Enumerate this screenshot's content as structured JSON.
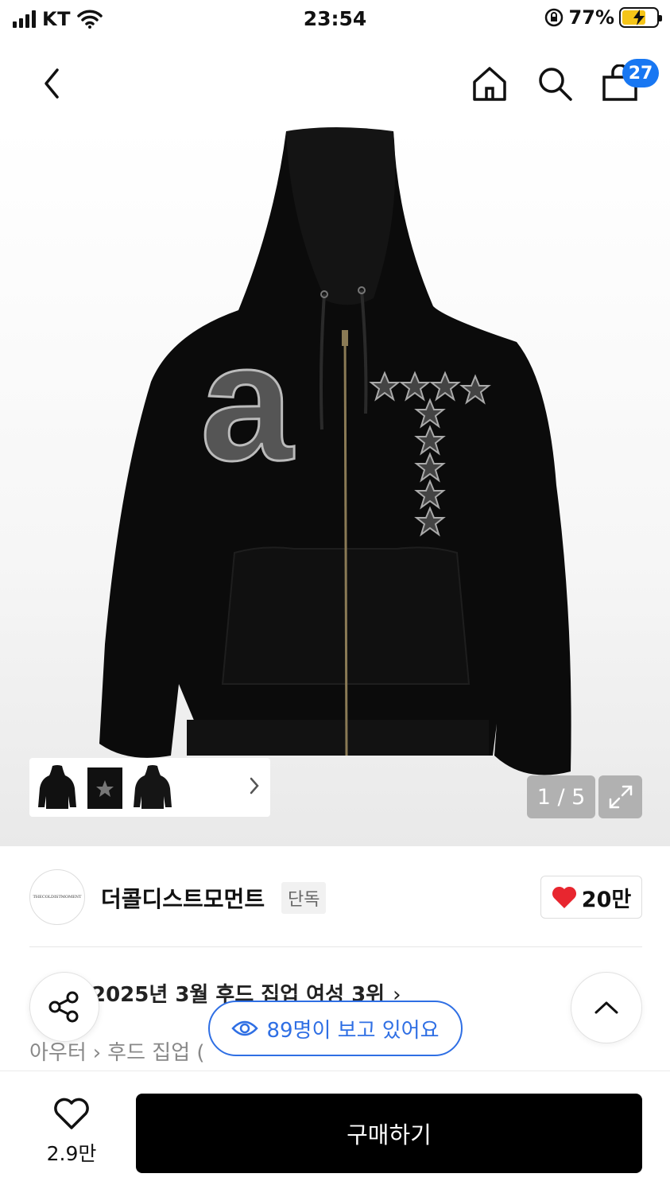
{
  "status_bar": {
    "carrier": "KT",
    "time": "23:54",
    "battery_percent": "77%",
    "icons": [
      "signal-icon",
      "wifi-icon",
      "rotation-lock-icon",
      "battery-charging-icon"
    ]
  },
  "nav": {
    "back_icon": "chevron-left-icon",
    "icons": [
      "home-icon",
      "search-icon",
      "cart-icon"
    ],
    "cart_badge": "27"
  },
  "gallery": {
    "counter": "1 / 5",
    "expand_icon": "expand-icon",
    "thumbnails_arrow_icon": "chevron-right-icon",
    "graphic_text": "a"
  },
  "brand": {
    "logo_text": "THECOLDISTMOMENT",
    "name": "더콜디스트모먼트",
    "badge": "단독",
    "likes": "20만",
    "like_color": "#e8262f"
  },
  "ranking": {
    "text": "2025년 3월 후드 집업 여성 3위",
    "chevron": "›"
  },
  "category": {
    "level1": "아우터",
    "separator": "›",
    "level2": "후드 집업",
    "suffix": "("
  },
  "viewers": {
    "text": "89명이 보고 있어요",
    "icon": "eye-icon",
    "color": "#2f6fe4"
  },
  "floating": {
    "share_icon": "share-icon",
    "top_icon": "chevron-up-icon"
  },
  "bottom_bar": {
    "wish_count": "2.9만",
    "buy_label": "구매하기"
  }
}
